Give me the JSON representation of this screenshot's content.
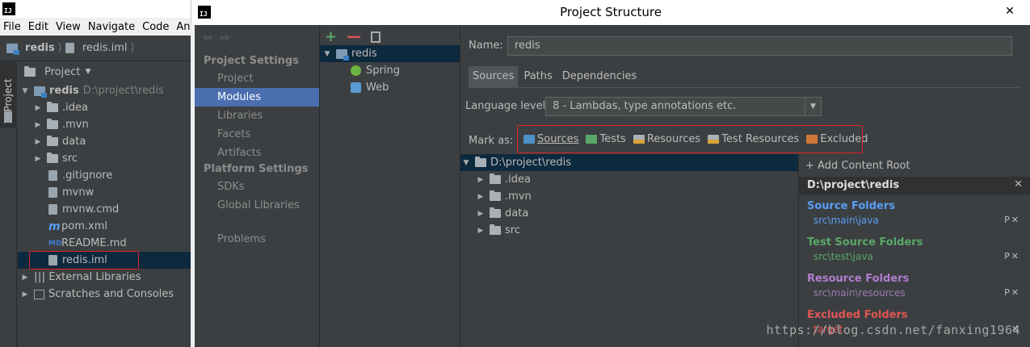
{
  "ide": {
    "logo": "IJ",
    "menu": [
      "File",
      "Edit",
      "View",
      "Navigate",
      "Code",
      "An"
    ],
    "breadcrumb": [
      "redis",
      "redis.iml"
    ],
    "side_tab": "1: Project",
    "project_view": "Project",
    "tree": [
      {
        "name": "redis",
        "path": "D:\\project\\redis",
        "kind": "module"
      },
      {
        "name": ".idea",
        "kind": "folder"
      },
      {
        "name": ".mvn",
        "kind": "folder"
      },
      {
        "name": "data",
        "kind": "folder"
      },
      {
        "name": "src",
        "kind": "folder"
      },
      {
        "name": ".gitignore",
        "kind": "file"
      },
      {
        "name": "mvnw",
        "kind": "file"
      },
      {
        "name": "mvnw.cmd",
        "kind": "file"
      },
      {
        "name": "pom.xml",
        "kind": "maven"
      },
      {
        "name": "README.md",
        "kind": "md"
      },
      {
        "name": "redis.iml",
        "kind": "file"
      },
      {
        "name": "External Libraries",
        "kind": "lib"
      },
      {
        "name": "Scratches and Consoles",
        "kind": "scratch"
      }
    ]
  },
  "dialog": {
    "logo": "IJ",
    "title": "Project Structure",
    "close": "✕",
    "categories": {
      "project_settings": "Project Settings",
      "project": "Project",
      "modules": "Modules",
      "libraries": "Libraries",
      "facets": "Facets",
      "artifacts": "Artifacts",
      "platform_settings": "Platform Settings",
      "sdks": "SDKs",
      "global_libraries": "Global Libraries",
      "problems": "Problems"
    },
    "modules": {
      "root": "redis",
      "children": [
        "Spring",
        "Web"
      ]
    },
    "detail": {
      "name_label": "Name:",
      "name_value": "redis",
      "tabs": [
        "Sources",
        "Paths",
        "Dependencies"
      ],
      "language_label": "Language level:",
      "language_value": "8 - Lambdas, type annotations etc.",
      "mark_as_label": "Mark as:",
      "mark_as": [
        "Sources",
        "Tests",
        "Resources",
        "Test Resources",
        "Excluded"
      ],
      "content_tree": {
        "root": "D:\\project\\redis",
        "children": [
          ".idea",
          ".mvn",
          "data",
          "src"
        ]
      },
      "roots": {
        "add": "+ Add Content Root",
        "root": "D:\\project\\redis",
        "source_title": "Source Folders",
        "source_path": "src\\main\\java",
        "test_title": "Test Source Folders",
        "test_path": "src\\test\\java",
        "resource_title": "Resource Folders",
        "resource_path": "src\\main\\resources",
        "excluded_title": "Excluded Folders",
        "excluded_path": "target",
        "btns": "P✕"
      }
    }
  },
  "watermark": "https://blog.csdn.net/fanxing1964",
  "colors": {
    "selection": "#4b6eaf",
    "source": "#589df6",
    "test": "#59a869",
    "resource": "#b07ccf",
    "excluded": "#e05555",
    "highlight_box": "#e0242a"
  }
}
